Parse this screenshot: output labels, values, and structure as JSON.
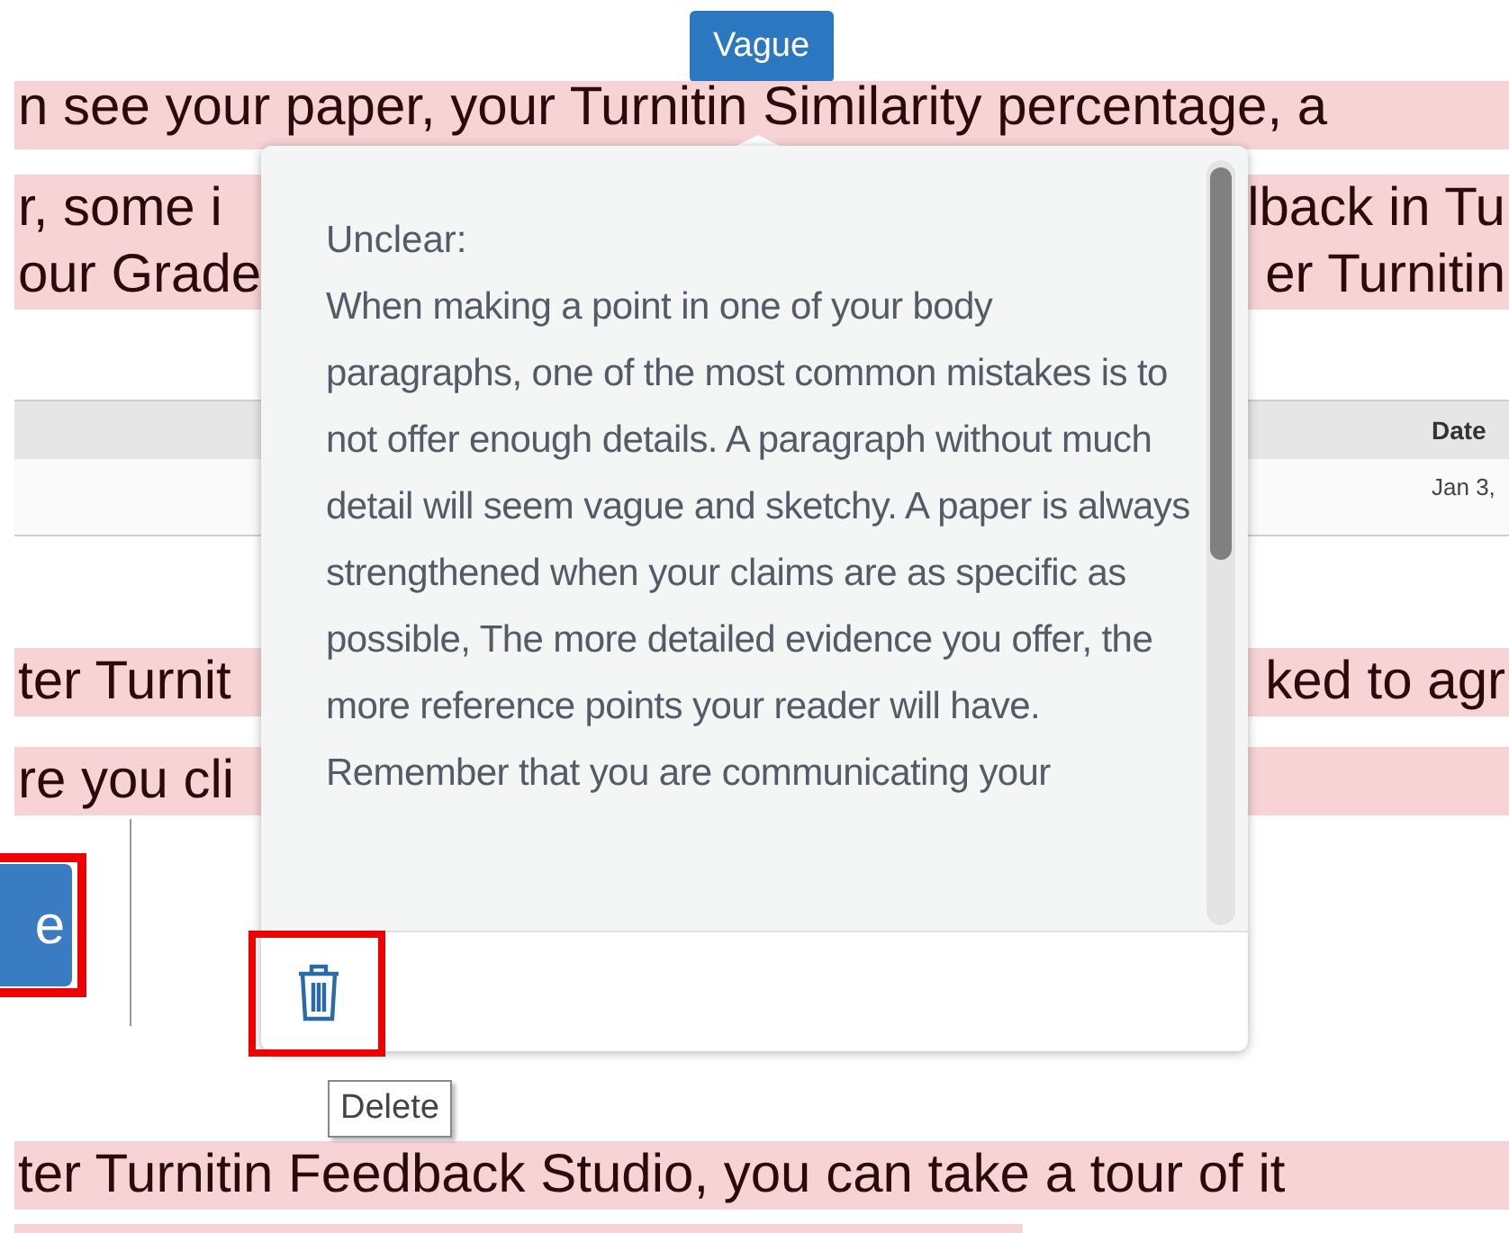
{
  "tag_button": {
    "label": "Vague"
  },
  "document_lines": [
    {
      "texts": [
        "n see your paper, your Turnitin Similarity percentage, a"
      ]
    },
    {
      "texts": [
        "r, some i",
        "lback in Tu"
      ]
    },
    {
      "texts": [
        "our Grade",
        "er Turnitin"
      ]
    }
  ],
  "table": {
    "columns": [
      "Date"
    ],
    "rows": [
      [
        "Jan 3,"
      ]
    ]
  },
  "document_lines_2": [
    {
      "texts": [
        "ter Turnit",
        "ked to agr"
      ]
    },
    {
      "texts": [
        "re you cli"
      ]
    }
  ],
  "side_button": {
    "label": "e"
  },
  "comment_popup": {
    "title": "Unclear:",
    "body": "When making a point in one of your body paragraphs, one of the most common mistakes is to not offer enough details. A paragraph without much detail will seem vague and sketchy. A paper is always strengthened when your claims are as specific as possible, The more detailed evidence you offer, the more reference points your reader will have. Remember that you are communicating your",
    "delete_tooltip": "Delete"
  },
  "document_lines_3": [
    {
      "texts": [
        "ter Turnitin Feedback Studio, you can take a tour of it"
      ]
    }
  ]
}
